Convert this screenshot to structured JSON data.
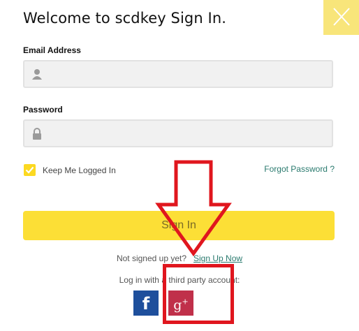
{
  "dialog": {
    "title": "Welcome to scdkey Sign In.",
    "accent_color": "#fcdf36"
  },
  "email": {
    "label": "Email Address",
    "value": "",
    "icon": "user-icon"
  },
  "password": {
    "label": "Password",
    "value": "",
    "icon": "lock-icon"
  },
  "remember": {
    "label": "Keep Me Logged In",
    "checked": true
  },
  "forgot_label": "Forgot Password ?",
  "signin_label": "Sign In",
  "signup": {
    "prefix": "Not signed up yet?",
    "link": "Sign Up Now"
  },
  "third_party": {
    "text": "Log in with a third party account:",
    "facebook_label": "f",
    "google_label": "g",
    "google_sup": "+"
  },
  "annotation_color": "#e0161e"
}
